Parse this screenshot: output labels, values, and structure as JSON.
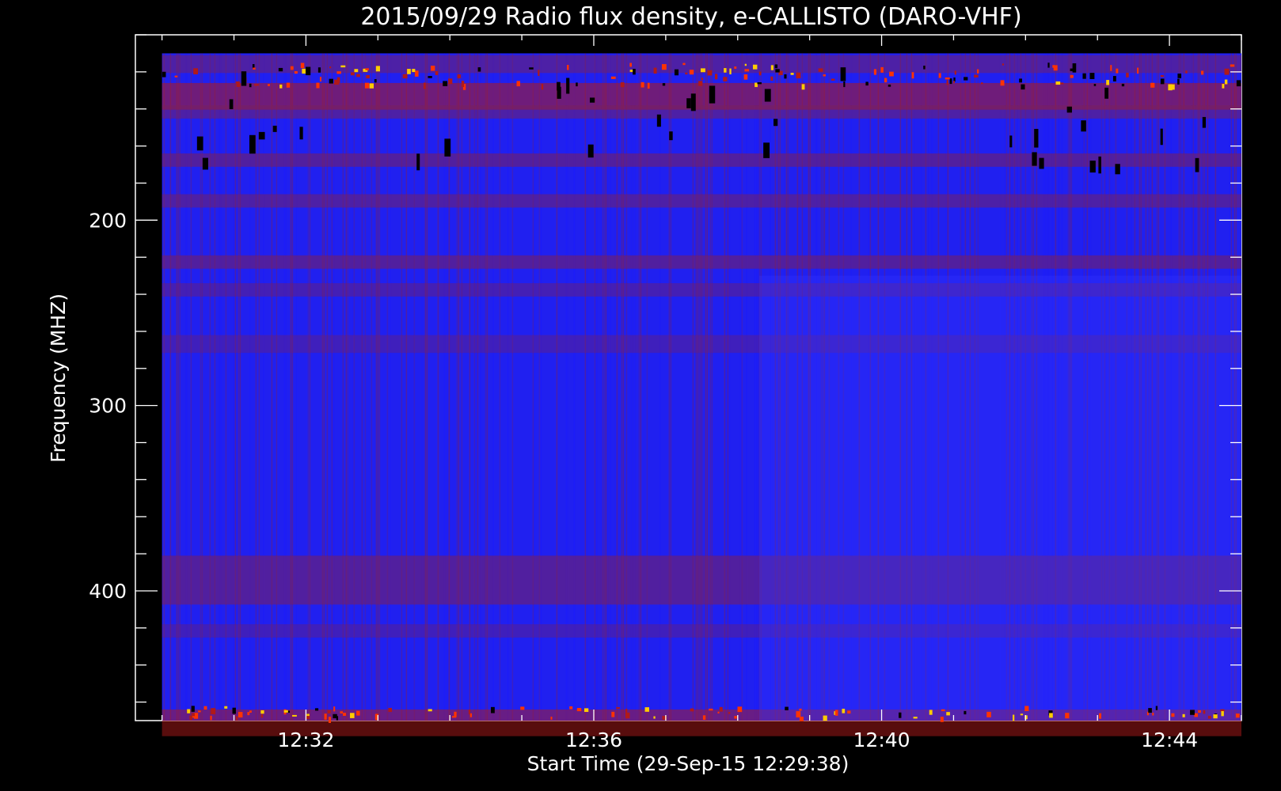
{
  "chart_data": {
    "type": "heatmap",
    "title": "2015/09/29  Radio flux density, e-CALLISTO (DARO-VHF)",
    "xlabel": "Start Time (29-Sep-15 12:29:38)",
    "ylabel": "Frequency (MHZ)",
    "x_ticks": [
      "12:32",
      "12:36",
      "12:40",
      "12:44"
    ],
    "x_tick_minutes": [
      32,
      36,
      40,
      44
    ],
    "y_ticks": [
      "200",
      "300",
      "400"
    ],
    "y_tick_values": [
      200,
      300,
      400
    ],
    "xlim_minutes": [
      29.63,
      45.0
    ],
    "ylim_mhz": [
      100,
      470
    ],
    "data_time_range_minutes": [
      30.0,
      45.0
    ],
    "data_freq_range_mhz": [
      110,
      470
    ],
    "y_inverted": true,
    "grid": false,
    "colormap": [
      "#000000",
      "#1a1aff",
      "#3333ff",
      "#7a1f5c",
      "#b01a1a",
      "#ff3300",
      "#ffcc00"
    ],
    "colors": {
      "background": "#000000",
      "foreground": "#ffffff",
      "base": "#2020f0"
    }
  }
}
